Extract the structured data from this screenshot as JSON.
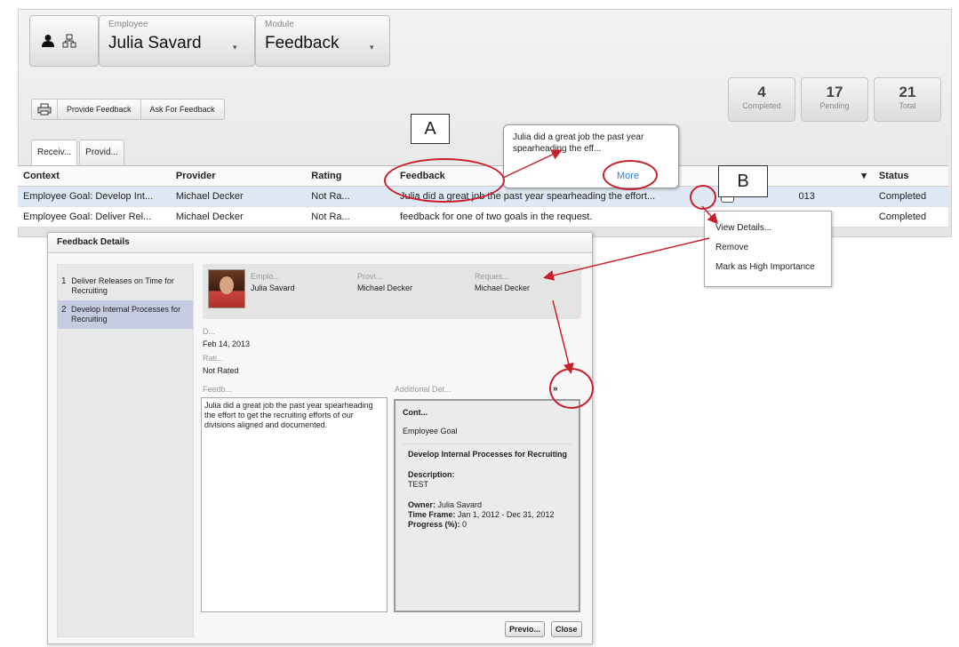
{
  "header": {
    "employee_label": "Employee",
    "employee_value": "Julia Savard",
    "module_label": "Module",
    "module_value": "Feedback",
    "caret": "▾",
    "person_icon": "person-icon",
    "org_icon": "org-chart-icon"
  },
  "toolbar": {
    "print_icon": "printer-icon",
    "provide_feedback": "Provide Feedback",
    "ask_for_feedback": "Ask For Feedback"
  },
  "stats": [
    {
      "number": "4",
      "label": "Completed"
    },
    {
      "number": "17",
      "label": "Pending"
    },
    {
      "number": "21",
      "label": "Total"
    }
  ],
  "tabs": [
    "Receiv...",
    "Provid..."
  ],
  "grid": {
    "columns": [
      "Context",
      "Provider",
      "Rating",
      "Feedback",
      "▾",
      "Status"
    ],
    "rows": [
      {
        "context": "Employee Goal: Develop Int...",
        "provider": "Michael Decker",
        "rating": "Not Ra...",
        "feedback": "Julia did a great job the past year spearheading the effort...",
        "date": "013",
        "status": "Completed"
      },
      {
        "context": "Employee Goal: Deliver Rel...",
        "provider": "Michael Decker",
        "rating": "Not Ra...",
        "feedback": "feedback for one of two goals in the request.",
        "date": "",
        "status": "Completed"
      }
    ]
  },
  "tooltip": {
    "text": "Julia did a great job the past year spearheading the eff...",
    "more": "More"
  },
  "callouts": {
    "a": "A",
    "b": "B"
  },
  "context_menu": [
    "View Details...",
    "Remove",
    "Mark as High Importance"
  ],
  "dialog": {
    "title": "Feedback Details",
    "nav": [
      {
        "num": "1",
        "label": "Deliver Releases on Time for Recruiting"
      },
      {
        "num": "2",
        "label": "Develop Internal Processes for Recruiting"
      }
    ],
    "employee_label": "Emplo...",
    "employee_value": "Julia Savard",
    "provider_label": "Provi...",
    "provider_value": "Michael Decker",
    "requester_label": "Reques...",
    "requester_value": "Michael Decker",
    "date_label": "D...",
    "date_value": "Feb 14, 2013",
    "rating_label": "Rati...",
    "rating_value": "Not Rated",
    "feedback_label": "Feedb...",
    "feedback_text": "Julia did a great job the past year spearheading the effort to get the recruiting efforts of our divisions aligned and documented.",
    "additional_label": "Additional Det...",
    "expand_icon": "»",
    "details": {
      "cont_label": "Cont...",
      "cont_value": "Employee Goal",
      "goal_title": "Develop Internal Processes for Recruiting",
      "description_label": "Description:",
      "description_value": "TEST",
      "owner_label": "Owner:",
      "owner_value": "Julia Savard",
      "timeframe_label": "Time Frame:",
      "timeframe_value": "Jan 1, 2012 - Dec 31, 2012",
      "progress_label": "Progress (%):",
      "progress_value": "0"
    },
    "prev_button": "Previo...",
    "close_button": "Close"
  },
  "colors": {
    "annotation": "#c8202a",
    "selected_row": "#dfe9f5",
    "link": "#2a7fd4"
  }
}
